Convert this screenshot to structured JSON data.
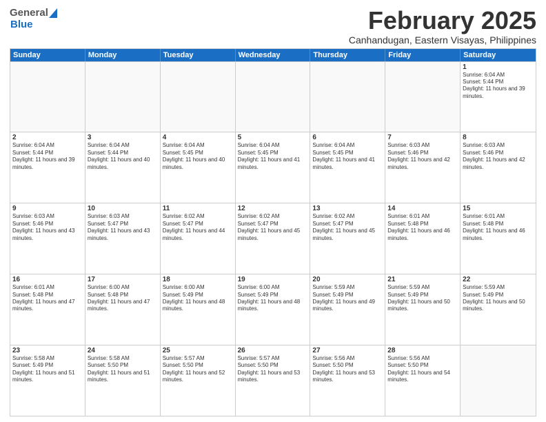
{
  "header": {
    "logo_general": "General",
    "logo_blue": "Blue",
    "month_title": "February 2025",
    "location": "Canhandugan, Eastern Visayas, Philippines"
  },
  "weekdays": [
    "Sunday",
    "Monday",
    "Tuesday",
    "Wednesday",
    "Thursday",
    "Friday",
    "Saturday"
  ],
  "weeks": [
    [
      {
        "day": "",
        "sunrise": "",
        "sunset": "",
        "daylight": "",
        "empty": true
      },
      {
        "day": "",
        "sunrise": "",
        "sunset": "",
        "daylight": "",
        "empty": true
      },
      {
        "day": "",
        "sunrise": "",
        "sunset": "",
        "daylight": "",
        "empty": true
      },
      {
        "day": "",
        "sunrise": "",
        "sunset": "",
        "daylight": "",
        "empty": true
      },
      {
        "day": "",
        "sunrise": "",
        "sunset": "",
        "daylight": "",
        "empty": true
      },
      {
        "day": "",
        "sunrise": "",
        "sunset": "",
        "daylight": "",
        "empty": true
      },
      {
        "day": "1",
        "sunrise": "Sunrise: 6:04 AM",
        "sunset": "Sunset: 5:44 PM",
        "daylight": "Daylight: 11 hours and 39 minutes.",
        "empty": false
      }
    ],
    [
      {
        "day": "2",
        "sunrise": "Sunrise: 6:04 AM",
        "sunset": "Sunset: 5:44 PM",
        "daylight": "Daylight: 11 hours and 39 minutes.",
        "empty": false
      },
      {
        "day": "3",
        "sunrise": "Sunrise: 6:04 AM",
        "sunset": "Sunset: 5:44 PM",
        "daylight": "Daylight: 11 hours and 40 minutes.",
        "empty": false
      },
      {
        "day": "4",
        "sunrise": "Sunrise: 6:04 AM",
        "sunset": "Sunset: 5:45 PM",
        "daylight": "Daylight: 11 hours and 40 minutes.",
        "empty": false
      },
      {
        "day": "5",
        "sunrise": "Sunrise: 6:04 AM",
        "sunset": "Sunset: 5:45 PM",
        "daylight": "Daylight: 11 hours and 41 minutes.",
        "empty": false
      },
      {
        "day": "6",
        "sunrise": "Sunrise: 6:04 AM",
        "sunset": "Sunset: 5:45 PM",
        "daylight": "Daylight: 11 hours and 41 minutes.",
        "empty": false
      },
      {
        "day": "7",
        "sunrise": "Sunrise: 6:03 AM",
        "sunset": "Sunset: 5:46 PM",
        "daylight": "Daylight: 11 hours and 42 minutes.",
        "empty": false
      },
      {
        "day": "8",
        "sunrise": "Sunrise: 6:03 AM",
        "sunset": "Sunset: 5:46 PM",
        "daylight": "Daylight: 11 hours and 42 minutes.",
        "empty": false
      }
    ],
    [
      {
        "day": "9",
        "sunrise": "Sunrise: 6:03 AM",
        "sunset": "Sunset: 5:46 PM",
        "daylight": "Daylight: 11 hours and 43 minutes.",
        "empty": false
      },
      {
        "day": "10",
        "sunrise": "Sunrise: 6:03 AM",
        "sunset": "Sunset: 5:47 PM",
        "daylight": "Daylight: 11 hours and 43 minutes.",
        "empty": false
      },
      {
        "day": "11",
        "sunrise": "Sunrise: 6:02 AM",
        "sunset": "Sunset: 5:47 PM",
        "daylight": "Daylight: 11 hours and 44 minutes.",
        "empty": false
      },
      {
        "day": "12",
        "sunrise": "Sunrise: 6:02 AM",
        "sunset": "Sunset: 5:47 PM",
        "daylight": "Daylight: 11 hours and 45 minutes.",
        "empty": false
      },
      {
        "day": "13",
        "sunrise": "Sunrise: 6:02 AM",
        "sunset": "Sunset: 5:47 PM",
        "daylight": "Daylight: 11 hours and 45 minutes.",
        "empty": false
      },
      {
        "day": "14",
        "sunrise": "Sunrise: 6:01 AM",
        "sunset": "Sunset: 5:48 PM",
        "daylight": "Daylight: 11 hours and 46 minutes.",
        "empty": false
      },
      {
        "day": "15",
        "sunrise": "Sunrise: 6:01 AM",
        "sunset": "Sunset: 5:48 PM",
        "daylight": "Daylight: 11 hours and 46 minutes.",
        "empty": false
      }
    ],
    [
      {
        "day": "16",
        "sunrise": "Sunrise: 6:01 AM",
        "sunset": "Sunset: 5:48 PM",
        "daylight": "Daylight: 11 hours and 47 minutes.",
        "empty": false
      },
      {
        "day": "17",
        "sunrise": "Sunrise: 6:00 AM",
        "sunset": "Sunset: 5:48 PM",
        "daylight": "Daylight: 11 hours and 47 minutes.",
        "empty": false
      },
      {
        "day": "18",
        "sunrise": "Sunrise: 6:00 AM",
        "sunset": "Sunset: 5:49 PM",
        "daylight": "Daylight: 11 hours and 48 minutes.",
        "empty": false
      },
      {
        "day": "19",
        "sunrise": "Sunrise: 6:00 AM",
        "sunset": "Sunset: 5:49 PM",
        "daylight": "Daylight: 11 hours and 48 minutes.",
        "empty": false
      },
      {
        "day": "20",
        "sunrise": "Sunrise: 5:59 AM",
        "sunset": "Sunset: 5:49 PM",
        "daylight": "Daylight: 11 hours and 49 minutes.",
        "empty": false
      },
      {
        "day": "21",
        "sunrise": "Sunrise: 5:59 AM",
        "sunset": "Sunset: 5:49 PM",
        "daylight": "Daylight: 11 hours and 50 minutes.",
        "empty": false
      },
      {
        "day": "22",
        "sunrise": "Sunrise: 5:59 AM",
        "sunset": "Sunset: 5:49 PM",
        "daylight": "Daylight: 11 hours and 50 minutes.",
        "empty": false
      }
    ],
    [
      {
        "day": "23",
        "sunrise": "Sunrise: 5:58 AM",
        "sunset": "Sunset: 5:49 PM",
        "daylight": "Daylight: 11 hours and 51 minutes.",
        "empty": false
      },
      {
        "day": "24",
        "sunrise": "Sunrise: 5:58 AM",
        "sunset": "Sunset: 5:50 PM",
        "daylight": "Daylight: 11 hours and 51 minutes.",
        "empty": false
      },
      {
        "day": "25",
        "sunrise": "Sunrise: 5:57 AM",
        "sunset": "Sunset: 5:50 PM",
        "daylight": "Daylight: 11 hours and 52 minutes.",
        "empty": false
      },
      {
        "day": "26",
        "sunrise": "Sunrise: 5:57 AM",
        "sunset": "Sunset: 5:50 PM",
        "daylight": "Daylight: 11 hours and 53 minutes.",
        "empty": false
      },
      {
        "day": "27",
        "sunrise": "Sunrise: 5:56 AM",
        "sunset": "Sunset: 5:50 PM",
        "daylight": "Daylight: 11 hours and 53 minutes.",
        "empty": false
      },
      {
        "day": "28",
        "sunrise": "Sunrise: 5:56 AM",
        "sunset": "Sunset: 5:50 PM",
        "daylight": "Daylight: 11 hours and 54 minutes.",
        "empty": false
      },
      {
        "day": "",
        "sunrise": "",
        "sunset": "",
        "daylight": "",
        "empty": true
      }
    ]
  ]
}
